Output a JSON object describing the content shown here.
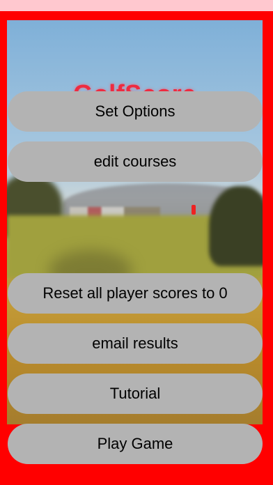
{
  "app": {
    "title": "GolfScore"
  },
  "menu": {
    "set_options": "Set Options",
    "edit_courses": "edit courses",
    "reset_scores": "Reset all player scores to 0",
    "email_results": "email results",
    "tutorial": "Tutorial",
    "play_game": "Play Game"
  },
  "colors": {
    "background": "#ff0000",
    "button": "#b3b3b3",
    "title": "#ee2b40",
    "status_strip": "#ffc8cf"
  }
}
